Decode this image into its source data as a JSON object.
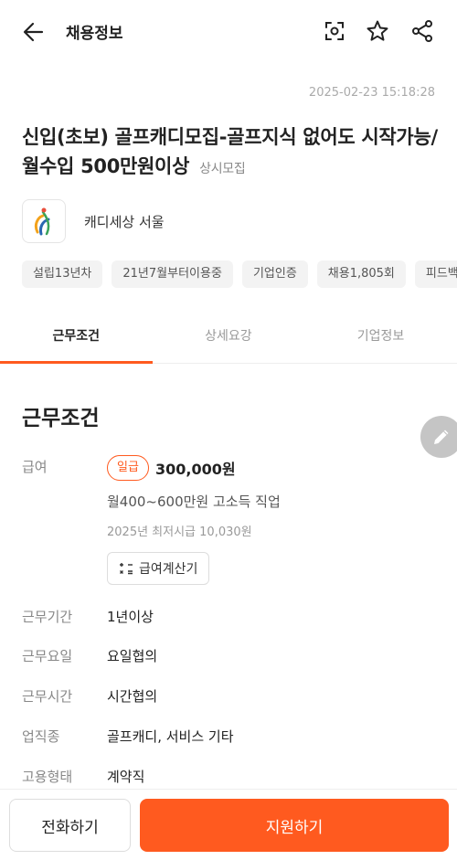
{
  "header": {
    "title": "채용정보",
    "icons": [
      "back-arrow-icon",
      "scan-icon",
      "star-icon",
      "share-icon"
    ]
  },
  "post": {
    "timestamp": "2025-02-23 15:18:28",
    "title": "신입(초보) 골프캐디모집-골프지식 없어도 시작가능/월수입 500만원이상",
    "badge": "상시모집"
  },
  "company": {
    "name": "캐디세상 서울"
  },
  "tags": [
    "설립13년차",
    "21년7월부터이용중",
    "기업인증",
    "채용1,805회",
    "피드백"
  ],
  "tabs": [
    {
      "label": "근무조건",
      "active": true
    },
    {
      "label": "상세요강",
      "active": false
    },
    {
      "label": "기업정보",
      "active": false
    }
  ],
  "conditions": {
    "section_title": "근무조건",
    "pay": {
      "label": "급여",
      "type_badge": "일급",
      "amount": "300,000원",
      "monthly": "월400~600만원 고소득 직업",
      "min_wage": "2025년 최저시급 10,030원",
      "calc_button": "급여계산기"
    },
    "rows": [
      {
        "label": "근무기간",
        "value": "1년이상"
      },
      {
        "label": "근무요일",
        "value": "요일협의"
      },
      {
        "label": "근무시간",
        "value": "시간협의"
      },
      {
        "label": "업직종",
        "value": "골프캐디, 서비스 기타"
      },
      {
        "label": "고용형태",
        "value": "계약직"
      }
    ]
  },
  "actions": {
    "call": "전화하기",
    "apply": "지원하기"
  },
  "colors": {
    "accent": "#ff5a1f"
  }
}
